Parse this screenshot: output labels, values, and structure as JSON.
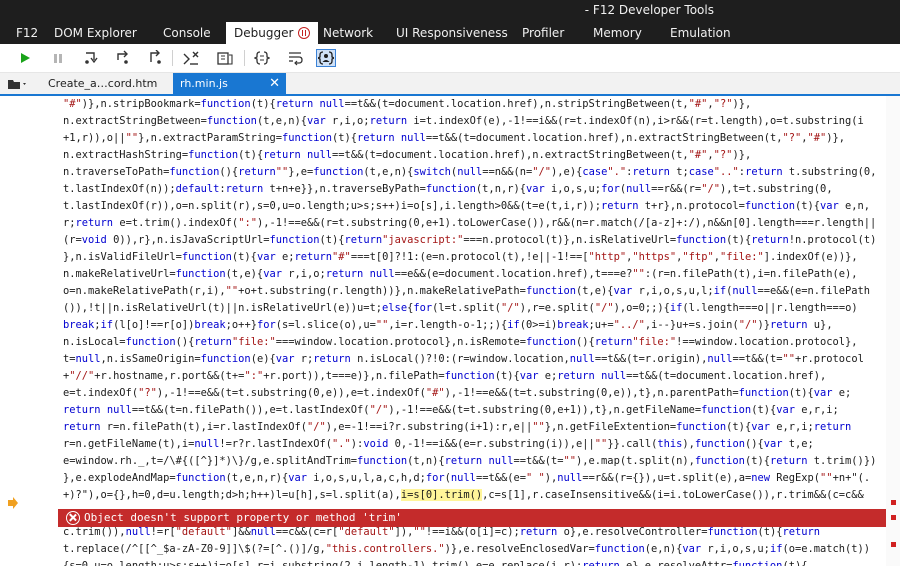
{
  "window": {
    "title": "- F12 Developer Tools"
  },
  "tabs": [
    {
      "label": "F12"
    },
    {
      "label": "DOM Explorer"
    },
    {
      "label": "Console"
    },
    {
      "label": "Debugger"
    },
    {
      "label": "Network"
    },
    {
      "label": "UI Responsiveness"
    },
    {
      "label": "Profiler"
    },
    {
      "label": "Memory"
    },
    {
      "label": "Emulation"
    }
  ],
  "toolbar": {
    "buttons": [
      "continue-icon",
      "break-all-icon",
      "step-into-icon",
      "step-over-icon",
      "step-out-icon",
      "break-on-new-worker-icon",
      "exception-behavior-icon",
      "pretty-print-icon",
      "word-wrap-icon",
      "just-my-code-icon"
    ]
  },
  "files": {
    "tabs": [
      "Create_a…cord.htm",
      "rh.min.js"
    ]
  },
  "colors": {
    "accent": "#1977d2",
    "error": "#c42b2b",
    "keyword": "#0000d0",
    "string": "#a31515"
  },
  "error": {
    "message": "Object doesn't support property or method 'trim'"
  },
  "code": [
    "\"#\")},n.stripBookmark=function(t){return null==t&&(t=document.location.href),n.stripStringBetween(t,\"#\",\"?\")},",
    "n.extractStringBetween=function(t,e,n){var r,i,o;return i=t.indexOf(e),-1!==i&&(r=t.indexOf(n),i>r&&(r=t.length),o=t.substring(i",
    "+1,r)),o||\"\"},n.extractParamString=function(t){return null==t&&(t=document.location.href),n.extractStringBetween(t,\"?\",\"#\")},",
    "n.extractHashString=function(t){return null==t&&(t=document.location.href),n.extractStringBetween(t,\"#\",\"?\")},",
    "n.traverseToPath=function(){return\"\"},e=function(t,e,n){switch(null==n&&(n=\"/\"),e){case\".\":return t;case\"..\":return t.substring(0,",
    "t.lastIndexOf(n));default:return t+n+e}},n.traverseByPath=function(t,n,r){var i,o,s,u;for(null==r&&(r=\"/\"),t=t.substring(0,",
    "t.lastIndexOf(r)),o=n.split(r),s=0,u=o.length;u>s;s++)i=o[s],i.length>0&&(t=e(t,i,r));return t+r},n.protocol=function(t){var e,n,",
    "r;return e=t.trim().indexOf(\":\"),-1!==e&&(r=t.substring(0,e+1).toLowerCase()),r&&(n=r.match(/[a-z]+:/),n&&n[0].length===r.length||",
    "(r=void 0)),r},n.isJavaScriptUrl=function(t){return\"javascript:\"===n.protocol(t)},n.isRelativeUrl=function(t){return!n.protocol(t)",
    "},n.isValidFileUrl=function(t){var e;return\"#\"===t[0]?!1:(e=n.protocol(t),!e||-1!==[\"http\",\"https\",\"ftp\",\"file:\"].indexOf(e))},",
    "n.makeRelativeUrl=function(t,e){var r,i,o;return null==e&&(e=document.location.href),t===e?\"\":(r=n.filePath(t),i=n.filePath(e),",
    "o=n.makeRelativePath(r,i),\"\"+o+t.substring(r.length))},n.makeRelativePath=function(t,e){var r,i,o,s,u,l;if(null==e&&(e=n.filePath",
    "()),!t||n.isRelativeUrl(t)||n.isRelativeUrl(e))u=t;else{for(l=t.split(\"/\"),r=e.split(\"/\"),o=0;;){if(l.length===o||r.length===o)",
    "break;if(l[o]!==r[o])break;o++}for(s=l.slice(o),u=\"\",i=r.length-o-1;;){if(0>=i)break;u+=\"../\",i--}u+=s.join(\"/\")}return u},",
    "n.isLocal=function(){return\"file:\"===window.location.protocol},n.isRemote=function(){return\"file:\"!==window.location.protocol},",
    "t=null,n.isSameOrigin=function(e){var r;return n.isLocal()?!0:(r=window.location,null==t&&(t=r.origin),null==t&&(t=\"\"+r.protocol",
    "+\"//\"+r.hostname,r.port&&(t+=\":\"+r.port)),t===e)},n.filePath=function(t){var e;return null==t&&(t=document.location.href),",
    "e=t.indexOf(\"?\"),-1!==e&&(t=t.substring(0,e)),e=t.indexOf(\"#\"),-1!==e&&(t=t.substring(0,e)),t},n.parentPath=function(t){var e;",
    "return null==t&&(t=n.filePath()),e=t.lastIndexOf(\"/\"),-1!==e&&(t=t.substring(0,e+1)),t},n.getFileName=function(t){var e,r,i;",
    "return r=n.filePath(t),i=r.lastIndexOf(\"/\"),e=-1!==i?r.substring(i+1):r,e||\"\"},n.getFileExtention=function(t){var e,r,i;return",
    "r=n.getFileName(t),i=null!=r?r.lastIndexOf(\".\"):void 0,-1!==i&&(e=r.substring(i)),e||\"\"}}.call(this),function(){var t,e;",
    "e=window.rh._,t=/\\#{([^}]*)\\}/g,e.splitAndTrim=function(t,n){return null==t&&(t=\"\"),e.map(t.split(n),function(t){return t.trim()})",
    "},e.explodeAndMap=function(t,e,n,r){var i,o,s,u,l,a,c,h,d;for(null==t&&(e=\" \"),null==r&&(r={}),u=t.split(e),a=new RegExp(\"\"+n+\"(.",
    "+)?\"),o={},h=0,d=u.length;d>h;h++)l=u[h],s=l.split(a),i=s[0].trim(),c=s[1],r.caseInsensitive&&(i=i.toLowerCase()),r.trim&&(c=c&&",
    "c.trim()),null!=r[\"default\"]&&null==c&&(c=r[\"default\"]),\"\"!==i&&(o[i]=c);return o},e.resolveController=function(t){return",
    "t.replace(/^[[^_$a-zA-Z0-9]]\\$(?=[^.()]/g,\"this.controllers.\")},e.resolveEnclosedVar=function(e,n){var r,i,o,s,u;if(o=e.match(t))",
    "{s=0,u=o.length;u>s;s++)i=o[s],r=i.substring(2,i.length-1).trim(),e=e.replace(i,r);return e},e.resolveAttr=function(t){"
  ]
}
